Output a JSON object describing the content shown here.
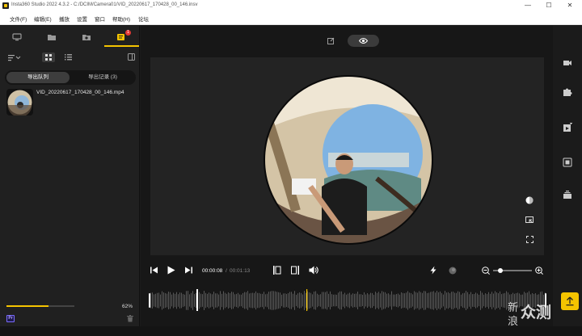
{
  "window": {
    "title": "Insta360 Studio 2022 4.3.2 - C:/DCIM/Camera01/VID_20220617_170428_00_146.insv",
    "minimize": "—",
    "maximize": "☐",
    "close": "✕"
  },
  "menu": [
    "文件(F)",
    "编辑(E)",
    "播放",
    "设置",
    "窗口",
    "帮助(H)",
    "论坛"
  ],
  "left_tabs": {
    "badge_count": "1"
  },
  "export_tabs": {
    "queue": "导出队列",
    "records": "导出记录 (3)"
  },
  "file": {
    "name": "VID_20220617_170428_00_146.mp4"
  },
  "export_progress": {
    "percent_label": "62%",
    "fraction": 0.62
  },
  "premiere_badge": "Pr",
  "playback": {
    "current_time": "00:00:08",
    "separator": "/",
    "total_time": "00:01:13"
  },
  "zoom_level": 0.15,
  "watermark": {
    "line1": "新",
    "line2": "浪",
    "brand": "众测"
  },
  "colors": {
    "accent": "#f5c400",
    "panel": "#202020",
    "preview_bg": "#232323"
  },
  "icons": {
    "left_tabs": [
      "monitor-icon",
      "folder-icon",
      "folder-camera-icon",
      "export-list-icon"
    ],
    "right_tools": [
      "video-camera-icon",
      "puzzle-icon",
      "add-media-icon",
      "ai-icon",
      "stack-icon"
    ]
  }
}
